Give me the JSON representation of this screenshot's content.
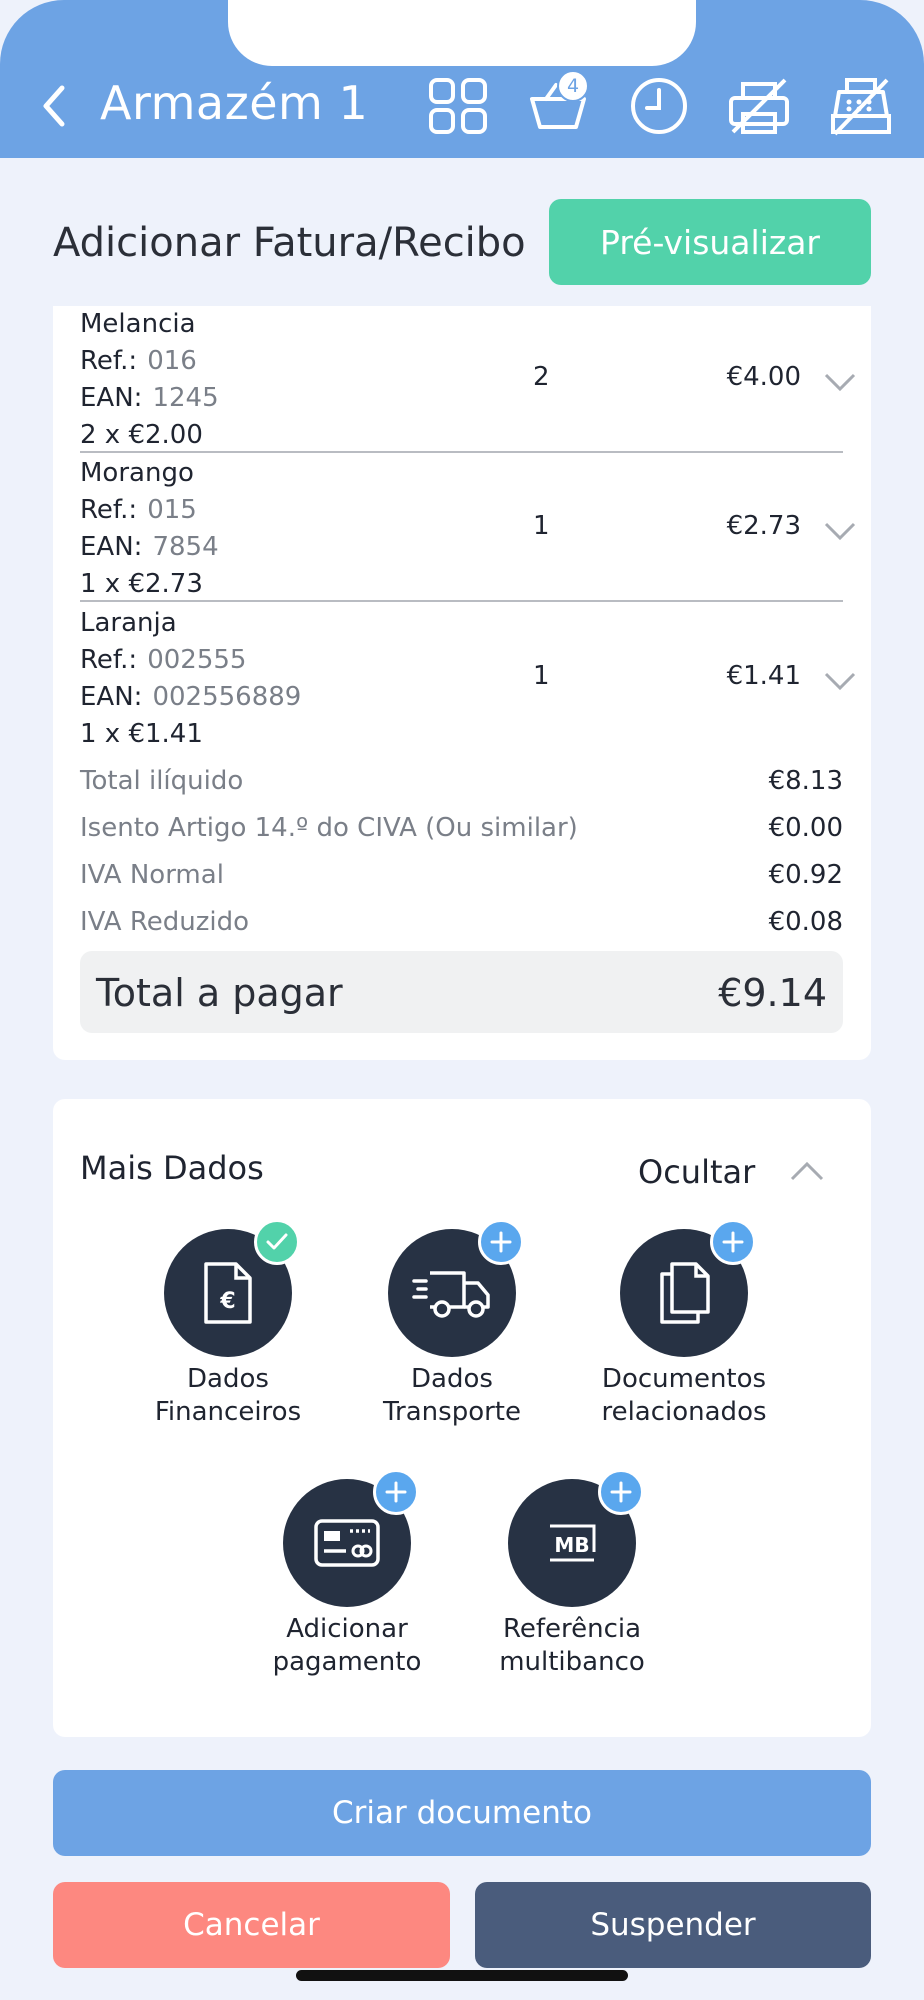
{
  "header": {
    "title": "Armazém 1",
    "basket_count": "4",
    "icons": [
      "back-chevron-icon",
      "grid-icon",
      "basket-icon",
      "clock-icon",
      "printer-off-icon",
      "cash-register-off-icon"
    ]
  },
  "page": {
    "title": "Adicionar Fatura/Recibo",
    "preview_label": "Pré-visualizar"
  },
  "items": [
    {
      "name": "Melancia",
      "ref_label": "Ref.:",
      "ref": "016",
      "ean_label": "EAN:",
      "ean": "1245",
      "unit_line": "2  x  €2.00",
      "qty": "2",
      "price": "€4.00"
    },
    {
      "name": "Morango",
      "ref_label": "Ref.:",
      "ref": "015",
      "ean_label": "EAN:",
      "ean": "7854",
      "unit_line": "1  x  €2.73",
      "qty": "1",
      "price": "€2.73"
    },
    {
      "name": "Laranja",
      "ref_label": "Ref.:",
      "ref": "002555",
      "ean_label": "EAN:",
      "ean": "002556889",
      "unit_line": "1  x  €1.41",
      "qty": "1",
      "price": "€1.41"
    }
  ],
  "summary": [
    {
      "label": "Total ilíquido",
      "amount": "€8.13"
    },
    {
      "label": "Isento Artigo 14.º do CIVA (Ou similar)",
      "amount": "€0.00"
    },
    {
      "label": "IVA Normal",
      "amount": "€0.92"
    },
    {
      "label": "IVA Reduzido",
      "amount": "€0.08"
    }
  ],
  "total": {
    "label": "Total a pagar",
    "amount": "€9.14"
  },
  "more": {
    "title": "Mais Dados",
    "toggle_label": "Ocultar",
    "actions": [
      {
        "line1": "Dados",
        "line2": "Financeiros",
        "badge": "check",
        "icon": "invoice-euro-icon"
      },
      {
        "line1": "Dados",
        "line2": "Transporte",
        "badge": "plus",
        "icon": "delivery-truck-icon"
      },
      {
        "line1": "Documentos",
        "line2": "relacionados",
        "badge": "plus",
        "icon": "documents-icon"
      },
      {
        "line1": "Adicionar",
        "line2": "pagamento",
        "badge": "plus",
        "icon": "payment-card-icon"
      },
      {
        "line1": "Referência",
        "line2": "multibanco",
        "badge": "plus",
        "icon": "multibanco-icon"
      }
    ]
  },
  "buttons": {
    "create": "Criar documento",
    "cancel": "Cancelar",
    "suspend": "Suspender"
  },
  "colors": {
    "header": "#6da3e4",
    "accent_green": "#52d2aa",
    "badge_blue": "#5aa7ee",
    "cancel": "#fd8880",
    "suspend": "#4a5c7c",
    "icon_circle": "#273244"
  }
}
